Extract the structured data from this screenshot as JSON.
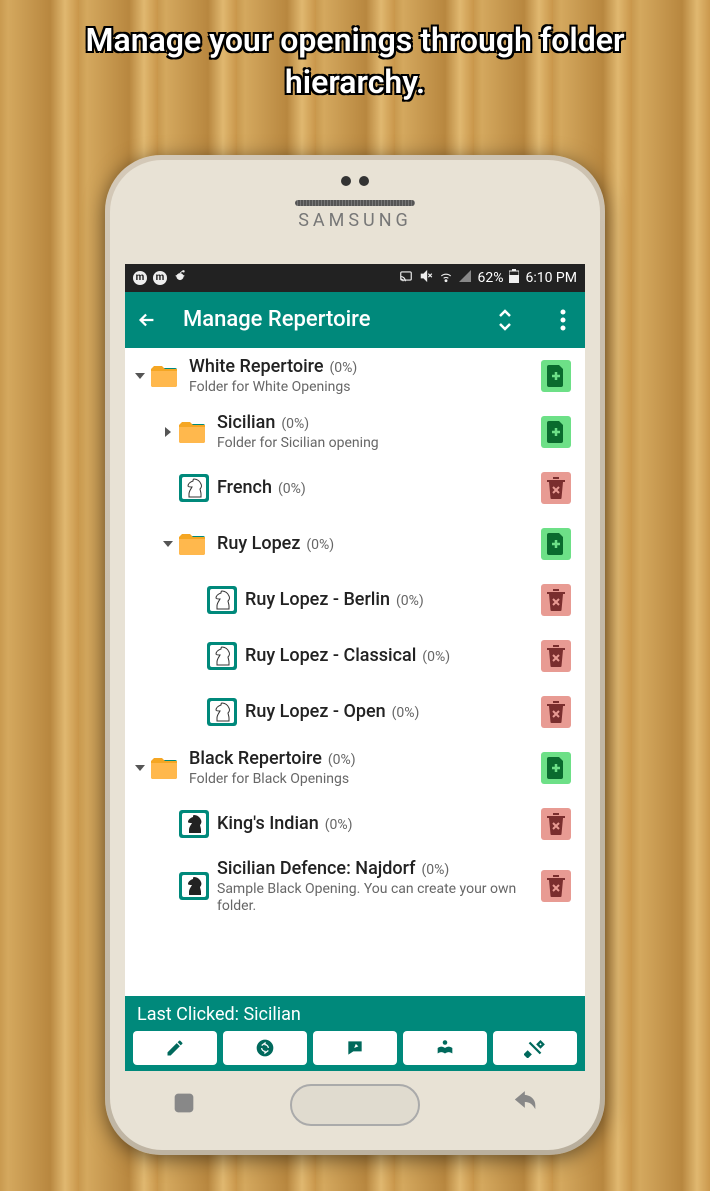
{
  "caption": "Manage your openings through folder hierarchy.",
  "phone_brand": "SAMSUNG",
  "status": {
    "battery": "62%",
    "time": "6:10 PM"
  },
  "appbar": {
    "title": "Manage Repertoire"
  },
  "tree": [
    {
      "level": 0,
      "expand": "down",
      "icon": "folder",
      "name": "White Repertoire",
      "pct": "(0%)",
      "sub": "Folder for White Openings",
      "action": "add"
    },
    {
      "level": 1,
      "expand": "right",
      "icon": "folder",
      "name": "Sicilian",
      "pct": "(0%)",
      "sub": "Folder for Sicilian opening",
      "action": "add"
    },
    {
      "level": 1,
      "expand": "",
      "icon": "white-knight",
      "name": "French",
      "pct": "(0%)",
      "sub": "",
      "action": "del"
    },
    {
      "level": 1,
      "expand": "down",
      "icon": "folder",
      "name": "Ruy Lopez",
      "pct": "(0%)",
      "sub": "",
      "action": "add"
    },
    {
      "level": 2,
      "expand": "",
      "icon": "white-knight",
      "name": "Ruy Lopez - Berlin",
      "pct": "(0%)",
      "sub": "",
      "action": "del"
    },
    {
      "level": 2,
      "expand": "",
      "icon": "white-knight",
      "name": "Ruy Lopez - Classical",
      "pct": "(0%)",
      "sub": "",
      "action": "del"
    },
    {
      "level": 2,
      "expand": "",
      "icon": "white-knight",
      "name": "Ruy Lopez - Open",
      "pct": "(0%)",
      "sub": "",
      "action": "del"
    },
    {
      "level": 0,
      "expand": "down",
      "icon": "folder",
      "name": "Black Repertoire",
      "pct": "(0%)",
      "sub": "Folder for Black Openings",
      "action": "add"
    },
    {
      "level": 1,
      "expand": "",
      "icon": "black-knight",
      "name": "King's Indian",
      "pct": "(0%)",
      "sub": "",
      "action": "del"
    },
    {
      "level": 1,
      "expand": "",
      "icon": "black-knight",
      "name": "Sicilian Defence: Najdorf",
      "pct": "(0%)",
      "sub": "Sample Black Opening. You can create your own folder.",
      "action": "del"
    }
  ],
  "footer": {
    "last_click": "Last Clicked: Sicilian"
  }
}
